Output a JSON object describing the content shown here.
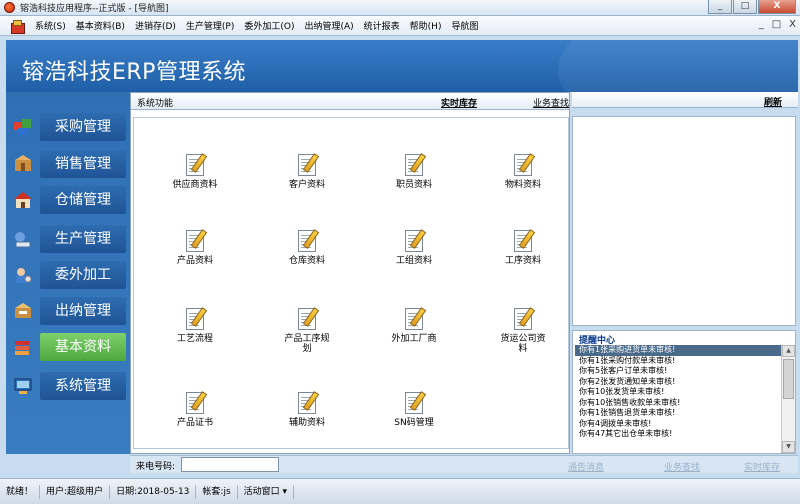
{
  "window": {
    "title": "镕浩科技应用程序--正式版 - [导航图]",
    "minimize": "_",
    "maximize": "□",
    "close": "X"
  },
  "menu": {
    "items": [
      "系统(S)",
      "基本资料(B)",
      "进销存(D)",
      "生产管理(P)",
      "委外加工(O)",
      "出纳管理(A)",
      "统计报表",
      "帮助(H)",
      "导航图"
    ],
    "mdi_controls": [
      "_",
      "□",
      "X"
    ]
  },
  "banner": {
    "title": "镕浩科技ERP管理系统"
  },
  "sidebar": {
    "items": [
      {
        "label": "采购管理",
        "icon": "purchase-icon"
      },
      {
        "label": "销售管理",
        "icon": "sales-icon"
      },
      {
        "label": "仓储管理",
        "icon": "warehouse-icon"
      },
      {
        "label": "生产管理",
        "icon": "production-icon"
      },
      {
        "label": "委外加工",
        "icon": "outsource-icon"
      },
      {
        "label": "出纳管理",
        "icon": "cashier-icon"
      },
      {
        "label": "基本资料",
        "icon": "basic-data-icon",
        "active": true
      },
      {
        "label": "系统管理",
        "icon": "system-icon"
      }
    ]
  },
  "panel": {
    "title": "系统功能",
    "link_inventory": "实时库存",
    "link_business": "业务查找",
    "refresh": "刷新"
  },
  "functions": [
    "供应商资料",
    "客户资料",
    "职员资料",
    "物料资料",
    "产品资料",
    "仓库资料",
    "工组资料",
    "工序资料",
    "工艺流程",
    "产品工序规划",
    "外加工厂商",
    "货运公司资料",
    "产品证书",
    "辅助资料",
    "SN码管理"
  ],
  "reminder": {
    "title": "提醒中心",
    "items": [
      "你有1张采购进货单未审核!",
      "你有1张采购付款单未审核!",
      "你有5张客户订单未审核!",
      "你有2张发货通知单未审核!",
      "你有10张发货单未审核!",
      "你有10张销售收款单未审核!",
      "你有1张销售退货单未审核!",
      "你有4调拨单未审核!",
      "你有47其它出仓单未审核!"
    ]
  },
  "bottom": {
    "phone_label": "来电号码:",
    "phone_value": "",
    "links": [
      "通告消息",
      "业务查找",
      "实时库存"
    ]
  },
  "status": {
    "items": [
      "就绪！",
      "用户:超级用户",
      "日期:2018-05-13",
      "帐套:js",
      "活动窗口 ▾"
    ]
  },
  "colors": {
    "banner": "#2a6cb8",
    "sidebar_active": "#5ab848",
    "reminder_selected": "#4a6a8a"
  }
}
